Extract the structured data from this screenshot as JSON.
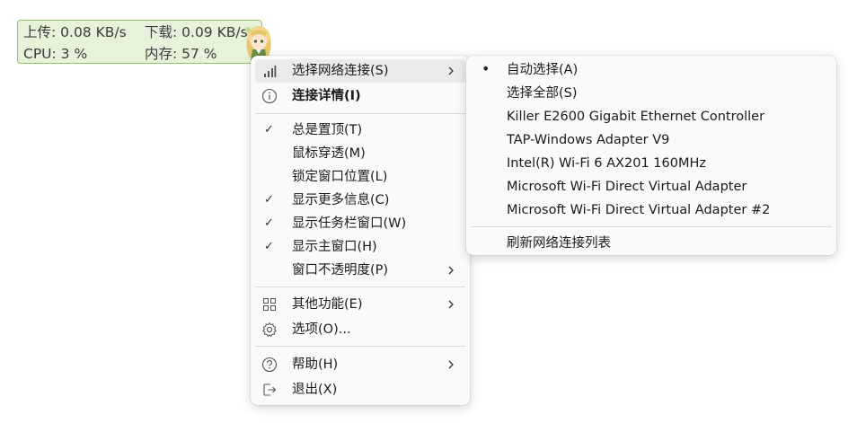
{
  "widget": {
    "upload_label": "上传: 0.08 KB/s",
    "download_label": "下载: 0.09 KB/s",
    "cpu_label": "CPU: 3 %",
    "mem_label": "内存: 57 %"
  },
  "main_menu": {
    "items": [
      {
        "label": "选择网络连接(S)",
        "icon": "signal-bars-icon"
      },
      {
        "label": "连接详情(I)",
        "icon": "info-icon"
      },
      {
        "label": "总是置顶(T)",
        "checked": true
      },
      {
        "label": "鼠标穿透(M)",
        "checked": false
      },
      {
        "label": "锁定窗口位置(L)",
        "checked": false
      },
      {
        "label": "显示更多信息(C)",
        "checked": true
      },
      {
        "label": "显示任务栏窗口(W)",
        "checked": true
      },
      {
        "label": "显示主窗口(H)",
        "checked": true
      },
      {
        "label": "窗口不透明度(P)"
      },
      {
        "label": "其他功能(E)",
        "icon": "grid-icon"
      },
      {
        "label": "选项(O)...",
        "icon": "gear-icon"
      },
      {
        "label": "帮助(H)",
        "icon": "help-icon"
      },
      {
        "label": "退出(X)",
        "icon": "exit-icon"
      }
    ]
  },
  "sub_menu": {
    "items": [
      {
        "label": "自动选择(A)",
        "selected": true
      },
      {
        "label": "选择全部(S)"
      },
      {
        "label": "Killer E2600 Gigabit Ethernet Controller"
      },
      {
        "label": "TAP-Windows Adapter V9"
      },
      {
        "label": "Intel(R) Wi-Fi 6 AX201 160MHz"
      },
      {
        "label": "Microsoft Wi-Fi Direct Virtual Adapter"
      },
      {
        "label": "Microsoft Wi-Fi Direct Virtual Adapter #2"
      },
      {
        "label": "刷新网络连接列表"
      }
    ]
  },
  "colors": {
    "widget_bg": "#e6f2da",
    "widget_border": "#8fc36a",
    "menu_bg": "#fafafa",
    "hover_bg": "#ebebeb"
  }
}
